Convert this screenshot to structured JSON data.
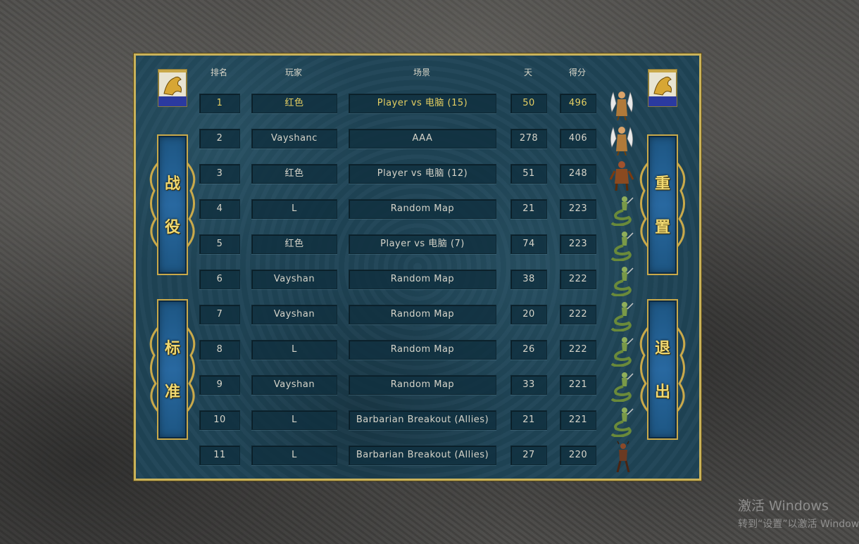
{
  "headers": {
    "rank": "排名",
    "player": "玩家",
    "scenario": "场景",
    "days": "天",
    "score": "得分"
  },
  "rows": [
    {
      "rank": "1",
      "player": "红色",
      "scenario": "Player vs 电脑 (15)",
      "days": "50",
      "score": "496",
      "portrait": "archangel"
    },
    {
      "rank": "2",
      "player": "Vayshanc",
      "scenario": "AAA",
      "days": "278",
      "score": "406",
      "portrait": "archangel"
    },
    {
      "rank": "3",
      "player": "红色",
      "scenario": "Player vs 电脑 (12)",
      "days": "51",
      "score": "248",
      "portrait": "titan"
    },
    {
      "rank": "4",
      "player": "L",
      "scenario": "Random Map",
      "days": "21",
      "score": "223",
      "portrait": "naga"
    },
    {
      "rank": "5",
      "player": "红色",
      "scenario": "Player vs 电脑 (7)",
      "days": "74",
      "score": "223",
      "portrait": "naga"
    },
    {
      "rank": "6",
      "player": "Vayshan",
      "scenario": "Random Map",
      "days": "38",
      "score": "222",
      "portrait": "naga"
    },
    {
      "rank": "7",
      "player": "Vayshan",
      "scenario": "Random Map",
      "days": "20",
      "score": "222",
      "portrait": "naga"
    },
    {
      "rank": "8",
      "player": "L",
      "scenario": "Random Map",
      "days": "26",
      "score": "222",
      "portrait": "naga"
    },
    {
      "rank": "9",
      "player": "Vayshan",
      "scenario": "Random Map",
      "days": "33",
      "score": "221",
      "portrait": "naga"
    },
    {
      "rank": "10",
      "player": "L",
      "scenario": "Barbarian Breakout (Allies)",
      "days": "21",
      "score": "221",
      "portrait": "naga"
    },
    {
      "rank": "11",
      "player": "L",
      "scenario": "Barbarian Breakout (Allies)",
      "days": "27",
      "score": "220",
      "portrait": "demon"
    }
  ],
  "buttons": {
    "campaign": {
      "char1": "战",
      "char2": "役"
    },
    "standard": {
      "char1": "标",
      "char2": "准"
    },
    "reset": {
      "char1": "重",
      "char2": "置"
    },
    "exit": {
      "char1": "退",
      "char2": "出"
    }
  },
  "watermark": {
    "line1": "激活 Windows",
    "line2": "转到“设置”以激活 Windows。"
  },
  "colors": {
    "highlight_text": "#e5cf62",
    "normal_text": "#d6d4c9",
    "panel_bg": "#1f4456",
    "gold_border": "#c9b25a",
    "button_blue": "#2868a0"
  }
}
